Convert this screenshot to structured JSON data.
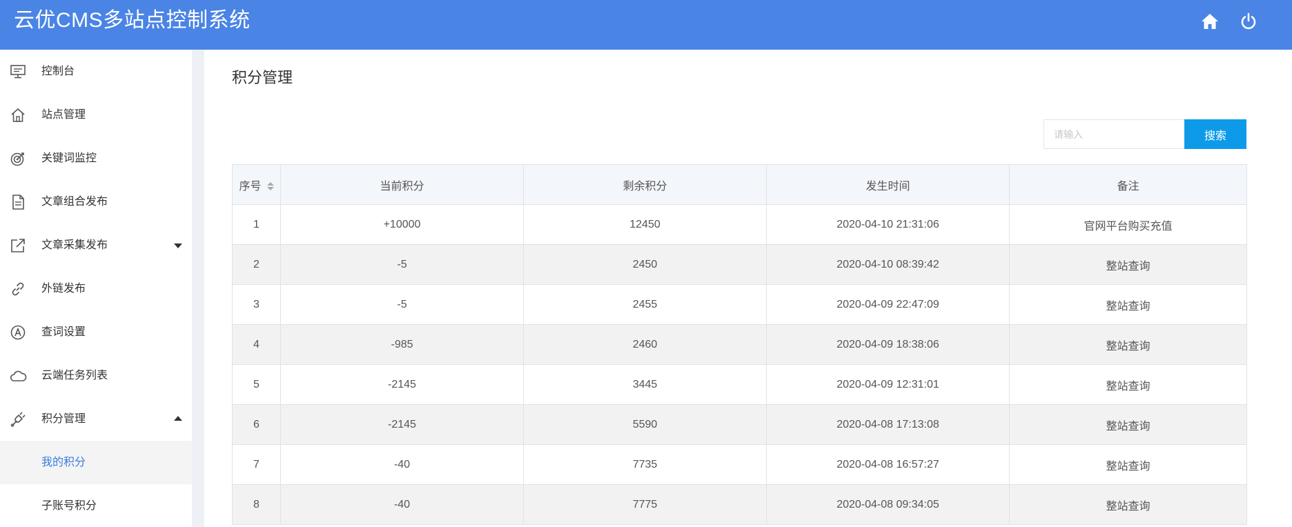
{
  "header": {
    "title": "云优CMS多站点控制系统",
    "icons": [
      "home-icon",
      "power-icon"
    ]
  },
  "sidebar": {
    "items": [
      {
        "label": "控制台",
        "icon": "monitor-icon"
      },
      {
        "label": "站点管理",
        "icon": "home-outline-icon"
      },
      {
        "label": "关键词监控",
        "icon": "target-icon"
      },
      {
        "label": "文章组合发布",
        "icon": "document-icon"
      },
      {
        "label": "文章采集发布",
        "icon": "external-link-icon",
        "expandable": true
      },
      {
        "label": "外链发布",
        "icon": "link-icon"
      },
      {
        "label": "查词设置",
        "icon": "a-circle-icon"
      },
      {
        "label": "云端任务列表",
        "icon": "cloud-icon"
      },
      {
        "label": "积分管理",
        "icon": "plug-icon",
        "expanded": true
      }
    ],
    "subitems": [
      {
        "label": "我的积分",
        "active": true
      },
      {
        "label": "子账号积分",
        "active": false
      }
    ],
    "active_color": "#3a7be0"
  },
  "main": {
    "page_title": "积分管理",
    "search": {
      "placeholder": "请输入",
      "button_label": "搜索"
    },
    "table": {
      "columns": [
        "序号",
        "当前积分",
        "剩余积分",
        "发生时间",
        "备注"
      ],
      "rows": [
        [
          "1",
          "+10000",
          "12450",
          "2020-04-10 21:31:06",
          "官网平台购买充值"
        ],
        [
          "2",
          "-5",
          "2450",
          "2020-04-10 08:39:42",
          "整站查询"
        ],
        [
          "3",
          "-5",
          "2455",
          "2020-04-09 22:47:09",
          "整站查询"
        ],
        [
          "4",
          "-985",
          "2460",
          "2020-04-09 18:38:06",
          "整站查询"
        ],
        [
          "5",
          "-2145",
          "3445",
          "2020-04-09 12:31:01",
          "整站查询"
        ],
        [
          "6",
          "-2145",
          "5590",
          "2020-04-08 17:13:08",
          "整站查询"
        ],
        [
          "7",
          "-40",
          "7735",
          "2020-04-08 16:57:27",
          "整站查询"
        ],
        [
          "8",
          "-40",
          "7775",
          "2020-04-08 09:34:05",
          "整站查询"
        ]
      ]
    }
  },
  "colors": {
    "header_bg": "#4a84e5",
    "search_button": "#0d9be9",
    "table_header_bg": "#f3f6fa",
    "row_alt_bg": "#f2f2f2"
  }
}
